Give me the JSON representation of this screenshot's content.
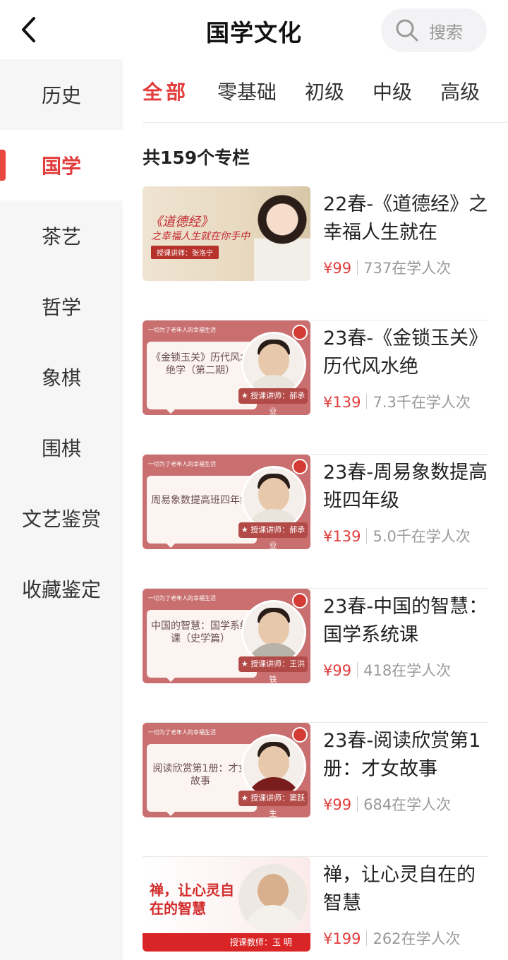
{
  "header": {
    "title": "国学文化",
    "search_label": "搜索"
  },
  "sidebar": {
    "items": [
      {
        "label": "历史",
        "active": false
      },
      {
        "label": "国学",
        "active": true
      },
      {
        "label": "茶艺",
        "active": false
      },
      {
        "label": "哲学",
        "active": false
      },
      {
        "label": "象棋",
        "active": false
      },
      {
        "label": "围棋",
        "active": false
      },
      {
        "label": "文艺鉴赏",
        "active": false
      },
      {
        "label": "收藏鉴定",
        "active": false
      }
    ]
  },
  "filters": [
    "全部",
    "零基础",
    "初级",
    "中级",
    "高级"
  ],
  "active_filter": "全部",
  "count_text": "共159个专栏",
  "courses": [
    {
      "title": "22春-《道德经》之幸福人生就在",
      "price": "¥99",
      "learners": "737在学人次",
      "thumb": {
        "line1": "《道德经》",
        "line2": "之幸福人生就在你手中",
        "teacher": "授课讲师：张洛宁"
      }
    },
    {
      "title": "23春-《金锁玉关》历代风水绝",
      "price": "¥139",
      "learners": "7.3千在学人次",
      "thumb": {
        "slogan": "一切为了老年人的幸福生活",
        "text": "《金锁玉关》历代风水绝学（第二期）",
        "teacher": "★ 授课讲师：郝承业"
      }
    },
    {
      "title": "23春-周易象数提高班四年级",
      "price": "¥139",
      "learners": "5.0千在学人次",
      "thumb": {
        "slogan": "一切为了老年人的幸福生活",
        "text": "周易象数提高班四年级",
        "teacher": "★ 授课讲师：郝承业"
      }
    },
    {
      "title": "23春-中国的智慧：国学系统课",
      "price": "¥99",
      "learners": "418在学人次",
      "thumb": {
        "slogan": "一切为了老年人的幸福生活",
        "text": "中国的智慧：国学系统课（史学篇）",
        "teacher": "★ 授课讲师：王洪铁"
      }
    },
    {
      "title": "23春-阅读欣赏第1册：才女故事",
      "price": "¥99",
      "learners": "684在学人次",
      "thumb": {
        "slogan": "一切为了老年人的幸福生活",
        "text": "阅读欣赏第1册：才女故事",
        "teacher": "★ 授课讲师：窦跃生"
      }
    },
    {
      "title": "禅，让心灵自在的智慧",
      "price": "¥199",
      "learners": "262在学人次",
      "thumb": {
        "text": "禅，让心灵自在的智慧",
        "teacher": "授课教师：玉 明"
      }
    }
  ],
  "colors": {
    "accent": "#e23b3b",
    "sidebar_bg": "#f6f6f6",
    "thumb_pink": "#c96f6f"
  }
}
